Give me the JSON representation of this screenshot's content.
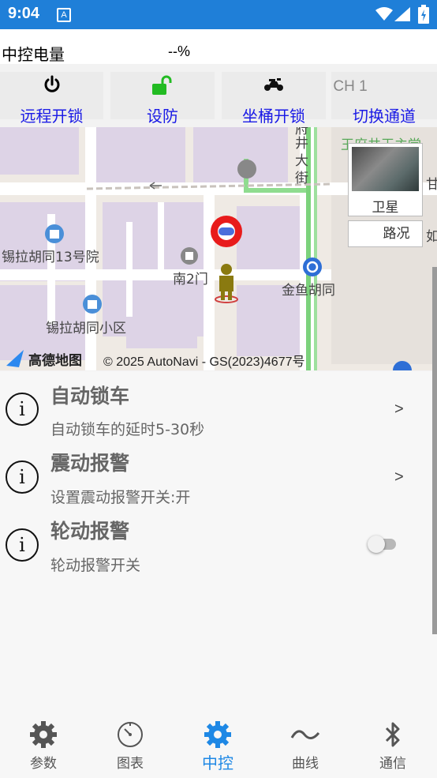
{
  "status_bar": {
    "time": "9:04",
    "notification_icon": "A"
  },
  "power": {
    "label": "中控电量",
    "value": "--%"
  },
  "controls": [
    {
      "label": "远程开锁",
      "icon": "power-icon"
    },
    {
      "label": "设防",
      "icon": "unlock-icon"
    },
    {
      "label": "坐桶开锁",
      "icon": "motorcycle-icon"
    },
    {
      "label": "切换通道",
      "channel": "CH 1"
    }
  ],
  "map": {
    "satellite_label": "卫星",
    "traffic_label": "路况",
    "places": {
      "yard13": "锡拉胡同13号院",
      "community": "锡拉胡同小区",
      "gate": "南2门",
      "jinyu": "金鱼胡同",
      "street": "井\n大\n街",
      "street_top": "府",
      "north": "王府井王主堂",
      "right_edge1": "甘",
      "right_edge2": "如"
    },
    "brand": "高德地图",
    "copyright": "© 2025 AutoNavi - GS(2023)4677号"
  },
  "settings": [
    {
      "title": "自动锁车",
      "desc": "自动锁车的延时5-30秒",
      "control": "arrow",
      "arrow": ">"
    },
    {
      "title": "震动报警",
      "desc": "设置震动报警开关:开",
      "control": "arrow",
      "arrow": ">"
    },
    {
      "title": "轮动报警",
      "desc": "轮动报警开关",
      "control": "toggle",
      "toggle_on": false
    }
  ],
  "bottom_nav": [
    {
      "label": "参数",
      "icon": "gear-icon",
      "active": false
    },
    {
      "label": "图表",
      "icon": "gauge-icon",
      "active": false
    },
    {
      "label": "中控",
      "icon": "gear-icon",
      "active": true
    },
    {
      "label": "曲线",
      "icon": "wave-icon",
      "active": false
    },
    {
      "label": "通信",
      "icon": "bluetooth-icon",
      "active": false
    }
  ],
  "colors": {
    "status_bar": "#1f7fd8",
    "control_label": "#1a1ae6",
    "active_nav": "#1e88e5",
    "lock_green": "#22bb22"
  }
}
